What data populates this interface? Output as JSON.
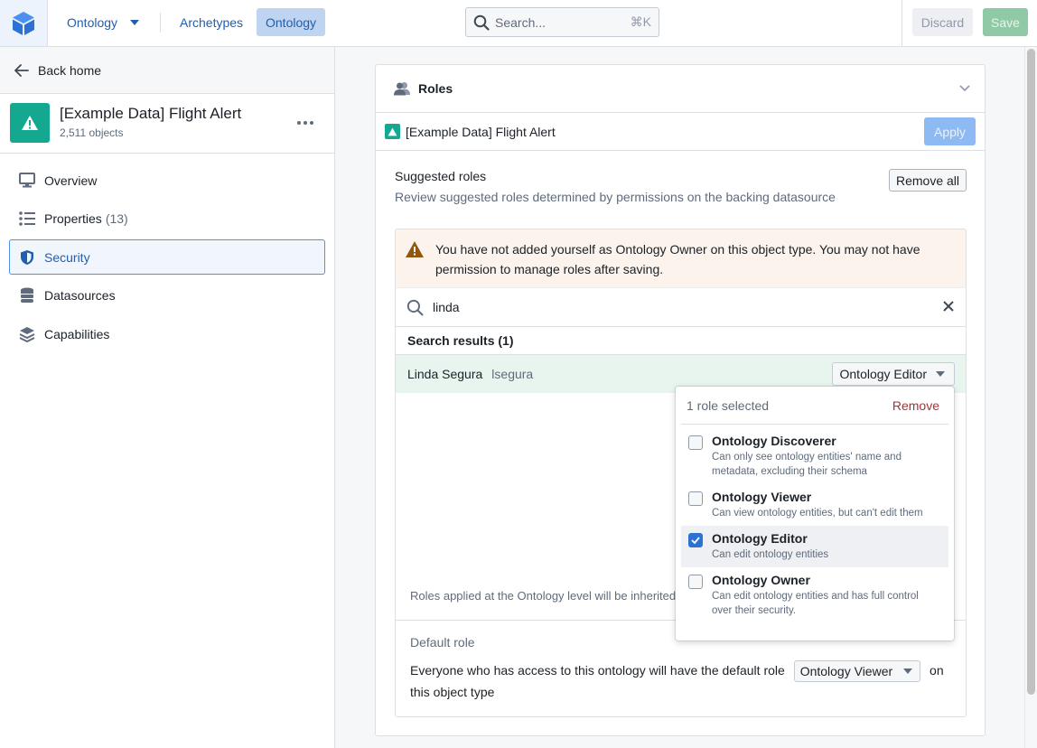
{
  "topbar": {
    "app_icon": "cube-icon",
    "nav_dropdown_label": "Ontology",
    "tabs": [
      {
        "label": "Archetypes",
        "active": false
      },
      {
        "label": "Ontology",
        "active": true
      }
    ],
    "search": {
      "placeholder": "Search...",
      "shortcut": "⌘K"
    },
    "discard_label": "Discard",
    "save_label": "Save"
  },
  "sidebar": {
    "back_label": "Back home",
    "object": {
      "title": "[Example Data] Flight Alert",
      "subtitle": "2,511 objects",
      "icon": "warning-icon",
      "color": "#13a88f"
    },
    "items": [
      {
        "label": "Overview",
        "count": "",
        "icon": "monitor-icon",
        "active": false
      },
      {
        "label": "Properties",
        "count": "(13)",
        "icon": "list-icon",
        "active": false
      },
      {
        "label": "Security",
        "count": "",
        "icon": "shield-icon",
        "active": true
      },
      {
        "label": "Datasources",
        "count": "",
        "icon": "database-icon",
        "active": false
      },
      {
        "label": "Capabilities",
        "count": "",
        "icon": "layers-icon",
        "active": false
      }
    ]
  },
  "main": {
    "section_title": "Roles",
    "object_name": "[Example Data] Flight Alert",
    "apply_label": "Apply",
    "suggested": {
      "title": "Suggested roles",
      "description": "Review suggested roles determined by permissions on the backing datasource",
      "remove_all_label": "Remove all"
    },
    "warning": "You have not added yourself as Ontology Owner on this object type. You may not have permission to manage roles after saving.",
    "search": {
      "value": "linda"
    },
    "results_header": "Search results (1)",
    "results": [
      {
        "name": "Linda Segura",
        "username": "lsegura",
        "role": "Ontology Editor"
      }
    ],
    "inherited_note": "Roles applied at the Ontology level will be inherited",
    "default_role": {
      "label": "Default role",
      "sentence_before": "Everyone who has access to this ontology will have the default role",
      "selected": "Ontology Viewer",
      "sentence_after": "on this object type"
    }
  },
  "role_popover": {
    "count_label": "1 role selected",
    "remove_label": "Remove",
    "options": [
      {
        "name": "Ontology Discoverer",
        "description": "Can only see ontology entities' name and metadata, excluding their schema",
        "checked": false
      },
      {
        "name": "Ontology Viewer",
        "description": "Can view ontology entities, but can't edit them",
        "checked": false
      },
      {
        "name": "Ontology Editor",
        "description": "Can edit ontology entities",
        "checked": true
      },
      {
        "name": "Ontology Owner",
        "description": "Can edit ontology entities and has full control over their security.",
        "checked": false
      }
    ]
  },
  "colors": {
    "accent": "#2d72d2",
    "object_teal": "#13a88f",
    "danger": "#ac2f33",
    "warning_bg": "#fbf3ec",
    "result_bg": "#e8f4ee"
  }
}
